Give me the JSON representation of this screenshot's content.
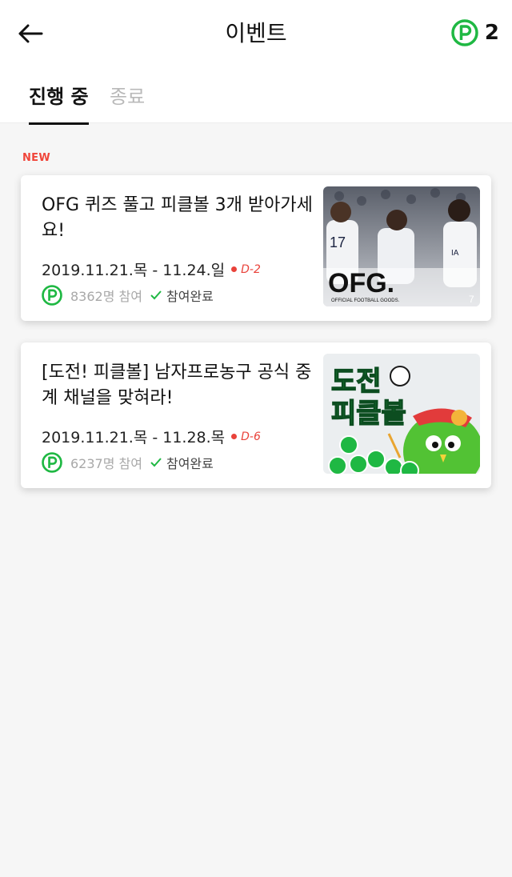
{
  "header": {
    "title": "이벤트",
    "back_icon": "arrow-left-icon",
    "points_icon": "point-coin-icon",
    "points": "2"
  },
  "tabs": [
    {
      "label": "진행 중",
      "active": true
    },
    {
      "label": "종료",
      "active": false
    }
  ],
  "section_label": "NEW",
  "colors": {
    "accent_green": "#1fb843",
    "dday_red": "#e9423a",
    "new_red": "#f0453a"
  },
  "events": [
    {
      "title": "OFG 퀴즈 풀고 피클볼 3개 받아가세요!",
      "dates": "2019.11.21.목 - 11.24.일",
      "dday": "D-2",
      "participants": "8362명 참여",
      "status": "참여완료",
      "thumb_text": "OFG.",
      "thumb_subtext": "OFFICIAL FOOTBALL GOODS."
    },
    {
      "title": "[도전! 피클볼] 남자프로농구 공식 중계 채널을 맞혀라!",
      "dates": "2019.11.21.목 - 11.28.목",
      "dday": "D-6",
      "participants": "6237명 참여",
      "status": "참여완료",
      "thumb_text_1": "도전",
      "thumb_text_2": "피클볼"
    }
  ]
}
